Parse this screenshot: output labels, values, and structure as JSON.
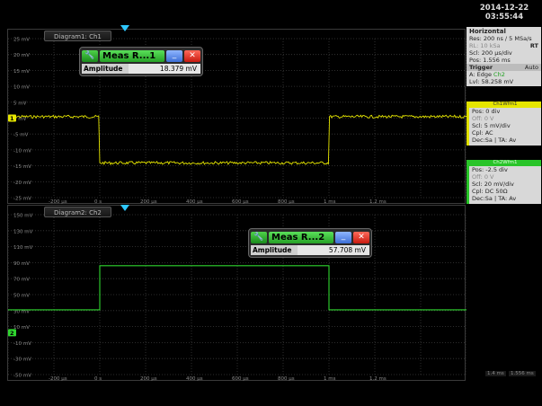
{
  "datetime": {
    "date": "2014-12-22",
    "time": "03:55:44"
  },
  "diagram1": {
    "tab_label": "Diagram1: Ch1",
    "y_ticks": [
      "25 mV",
      "20 mV",
      "15 mV",
      "10 mV",
      "5 mV",
      "0 mV",
      "-5 mV",
      "-10 mV",
      "-15 mV",
      "-20 mV",
      "-25 mV"
    ],
    "x_ticks": [
      "-200 µs",
      "0 s",
      "200 µs",
      "400 µs",
      "600 µs",
      "800 µs",
      "1 ms",
      "1.2 ms"
    ],
    "ch_marker": "1",
    "measurement": {
      "title": "Meas R...1",
      "label": "Amplitude",
      "value": "18.379 mV"
    }
  },
  "diagram2": {
    "tab_label": "Diagram2: Ch2",
    "y_ticks": [
      "150 mV",
      "130 mV",
      "110 mV",
      "90 mV",
      "70 mV",
      "50 mV",
      "30 mV",
      "10 mV",
      "-10 mV",
      "-30 mV",
      "-50 mV"
    ],
    "x_ticks": [
      "-200 µs",
      "0 s",
      "200 µs",
      "400 µs",
      "600 µs",
      "800 µs",
      "1 ms",
      "1.2 ms"
    ],
    "ch_marker": "2",
    "measurement": {
      "title": "Meas R...2",
      "label": "Amplitude",
      "value": "57.708 mV"
    },
    "time_readout_left": "1.4 ms",
    "time_readout_right": "1.556 ms"
  },
  "horizontal": {
    "title": "Horizontal",
    "res": "Res: 200 ns / 5 MSa/s",
    "rt": "RT",
    "rl": "RL:  10 kSa",
    "scl": "Scl:  200 µs/div",
    "pos": "Pos: 1.556 ms",
    "trigger_title": "Trigger",
    "trigger_mode": "Auto",
    "trig_a": "A:    Edge",
    "trig_src": "Ch2",
    "trig_lvl": "Lvl:  58.258 mV"
  },
  "ch1": {
    "header": "Ch1Wfm1",
    "pos": "Pos: 0 div",
    "off": "Off: 0 V",
    "scl": "Scl: 5 mV/div",
    "cpl": "Cpl: AC",
    "dec": "Dec:Sa | TA: Av"
  },
  "ch2": {
    "header": "Ch2Wfm1",
    "pos": "Pos: -2.5 div",
    "off": "Off: 0 V",
    "scl": "Scl: 20 mV/div",
    "cpl": "Cpl: DC 50Ω",
    "dec": "Dec:Sa | TA: Av"
  },
  "colors": {
    "ch1": "#e6e600",
    "ch2": "#2fd62f",
    "trigger": "#2ec8ff",
    "grid": "#3a3a3a"
  },
  "signal_ch1": {
    "high_mV": 0.5,
    "low_mV": -15.5,
    "edges_ms": [
      0,
      1.0
    ]
  },
  "signal_ch2": {
    "low_mV": 30,
    "high_mV": 88,
    "edges_ms": [
      0,
      1.0
    ]
  }
}
